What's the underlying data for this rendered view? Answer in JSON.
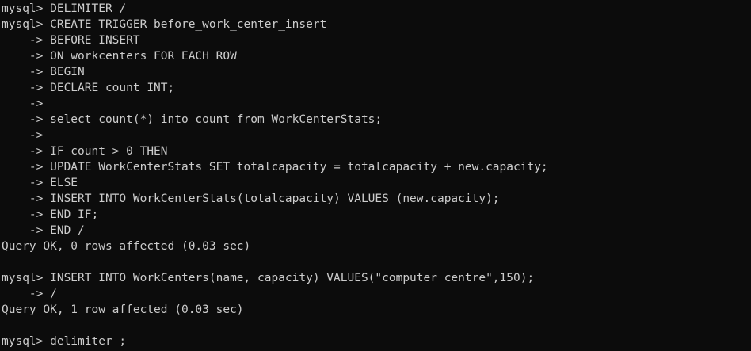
{
  "colors": {
    "background": "#0c0c0c",
    "text": "#cccccc"
  },
  "lines": [
    "mysql> DELIMITER /",
    "mysql> CREATE TRIGGER before_work_center_insert",
    "    -> BEFORE INSERT",
    "    -> ON workcenters FOR EACH ROW",
    "    -> BEGIN",
    "    -> DECLARE count INT;",
    "    ->",
    "    -> select count(*) into count from WorkCenterStats;",
    "    ->",
    "    -> IF count > 0 THEN",
    "    -> UPDATE WorkCenterStats SET totalcapacity = totalcapacity + new.capacity;",
    "    -> ELSE",
    "    -> INSERT INTO WorkCenterStats(totalcapacity) VALUES (new.capacity);",
    "    -> END IF;",
    "    -> END /",
    "Query OK, 0 rows affected (0.03 sec)",
    "",
    "mysql> INSERT INTO WorkCenters(name, capacity) VALUES(\"computer centre\",150);",
    "    -> /",
    "Query OK, 1 row affected (0.03 sec)",
    "",
    "mysql> delimiter ;"
  ]
}
